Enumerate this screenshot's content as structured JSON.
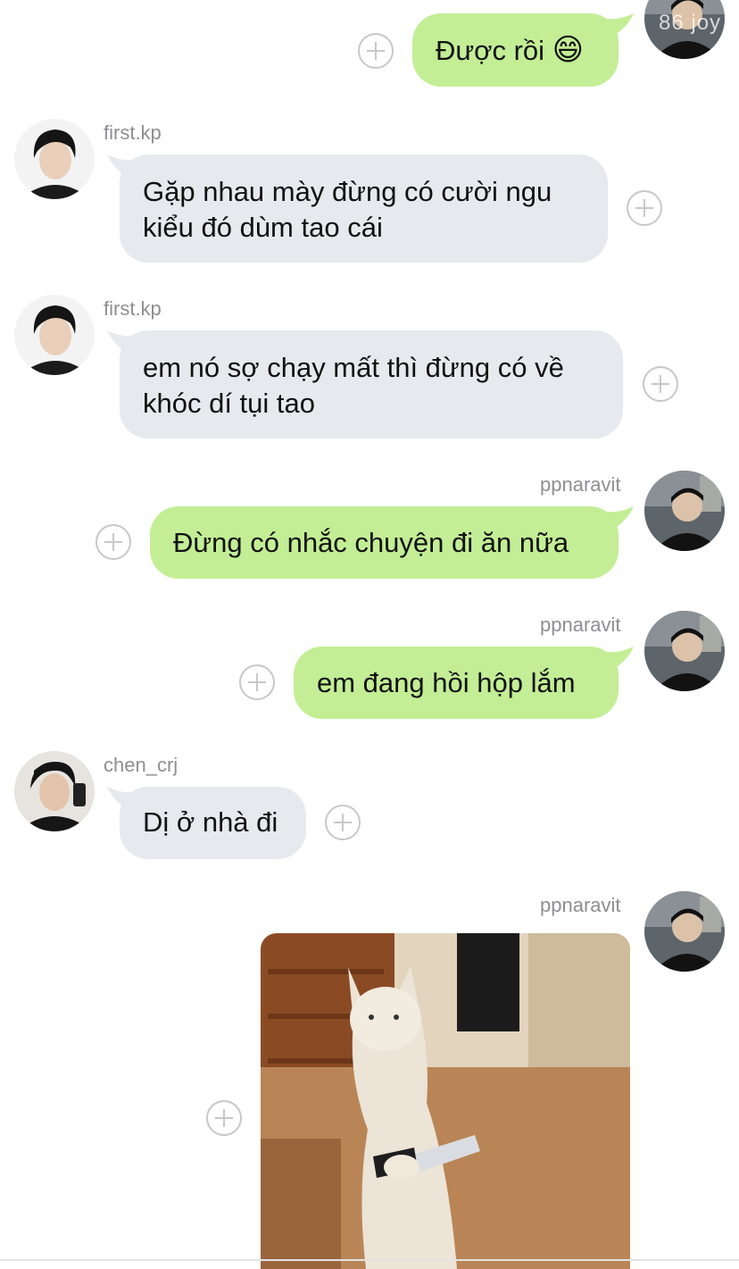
{
  "top": {
    "watermark_text": "86 joy"
  },
  "messages": [
    {
      "sender": "",
      "text": "Được rồi",
      "emoji": "😄"
    },
    {
      "sender": "first.kp",
      "lines": [
        "Gặp nhau mày đừng có cười ngu",
        "kiểu đó dùm tao cái"
      ]
    },
    {
      "sender": "first.kp",
      "lines": [
        "em nó sợ chạy mất thì đừng có về",
        "khóc dí tụi tao"
      ]
    },
    {
      "sender": "ppnaravit",
      "text": "Đừng có nhắc chuyện đi ăn nữa"
    },
    {
      "sender": "ppnaravit",
      "text": "em đang hồi hộp lắm"
    },
    {
      "sender": "chen_crj",
      "text": "Dị ở nhà đi"
    },
    {
      "sender": "ppnaravit",
      "text": ""
    }
  ],
  "colors": {
    "incoming_bubble": "#e6e9ee",
    "outgoing_bubble": "#c3ee95",
    "username": "#8e8e93",
    "add_reaction_icon": "#c7c7cc"
  },
  "icons": {
    "reaction": "add-reaction-icon",
    "avatar": "user-avatar"
  }
}
